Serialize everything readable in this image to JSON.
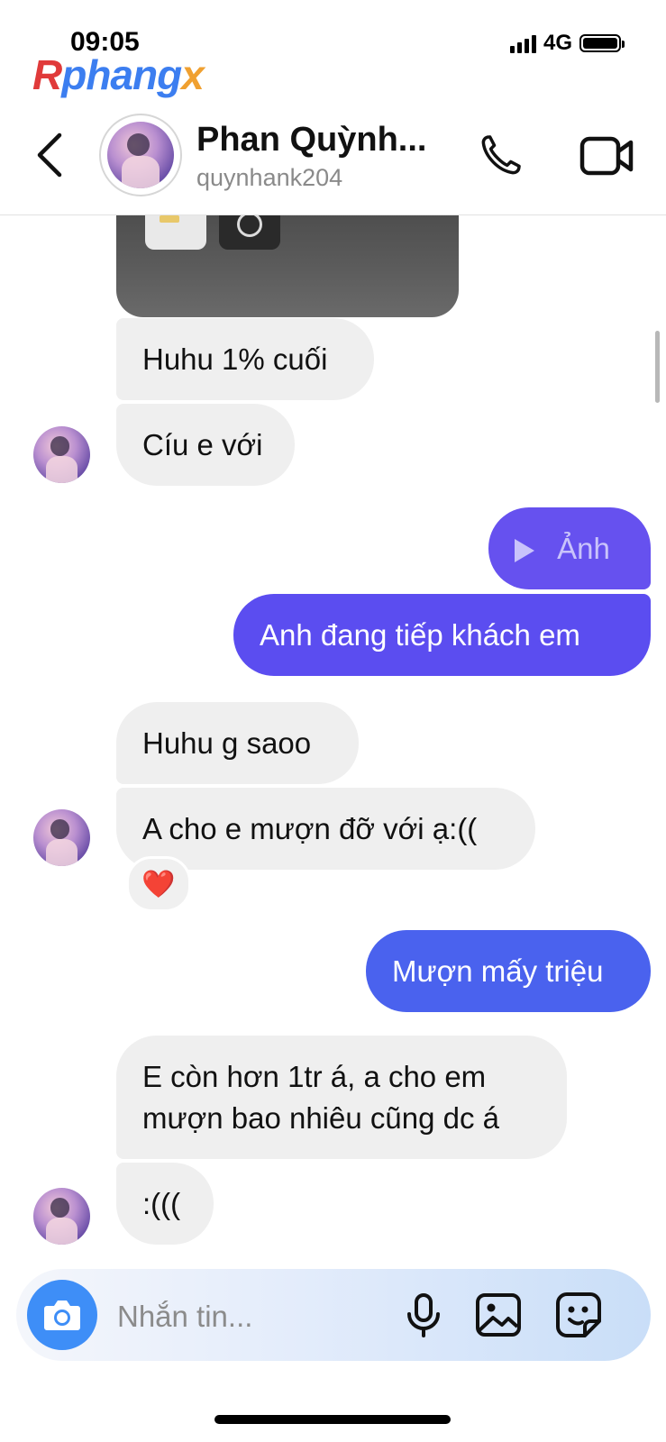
{
  "status_bar": {
    "time": "09:05",
    "network": "4G"
  },
  "watermark": {
    "part1": "R",
    "part2": "phang",
    "part3": "x"
  },
  "header": {
    "contact_name": "Phan Quỳnh...",
    "username": "quynhank204"
  },
  "messages": [
    {
      "side": "in",
      "text": "Huhu 1% cuối"
    },
    {
      "side": "in",
      "text": "Cíu e với"
    },
    {
      "side": "out",
      "type": "media",
      "text": "Ảnh"
    },
    {
      "side": "out",
      "text": "Anh đang tiếp khách em"
    },
    {
      "side": "in",
      "text": "Huhu g saoo"
    },
    {
      "side": "in",
      "text": "A cho e mượn đỡ với ạ:((",
      "reaction": "❤️"
    },
    {
      "side": "out",
      "text": "Mượn mấy triệu"
    },
    {
      "side": "in",
      "text_line1": "E còn hơn 1tr á, a cho em",
      "text_line2": "mượn bao nhiêu cũng dc á"
    },
    {
      "side": "in",
      "text": ":((("
    }
  ],
  "composer": {
    "placeholder": "Nhắn tin..."
  },
  "colors": {
    "incoming": "#efefef",
    "outgoing_purple": "#5b4df0",
    "outgoing_blue": "#4a62ee",
    "camera_button": "#3e8ef7"
  },
  "icons": [
    "back-chevron-icon",
    "phone-icon",
    "video-camera-icon",
    "camera-icon",
    "microphone-icon",
    "gallery-icon",
    "sticker-icon",
    "play-icon",
    "heart-reaction-icon"
  ]
}
